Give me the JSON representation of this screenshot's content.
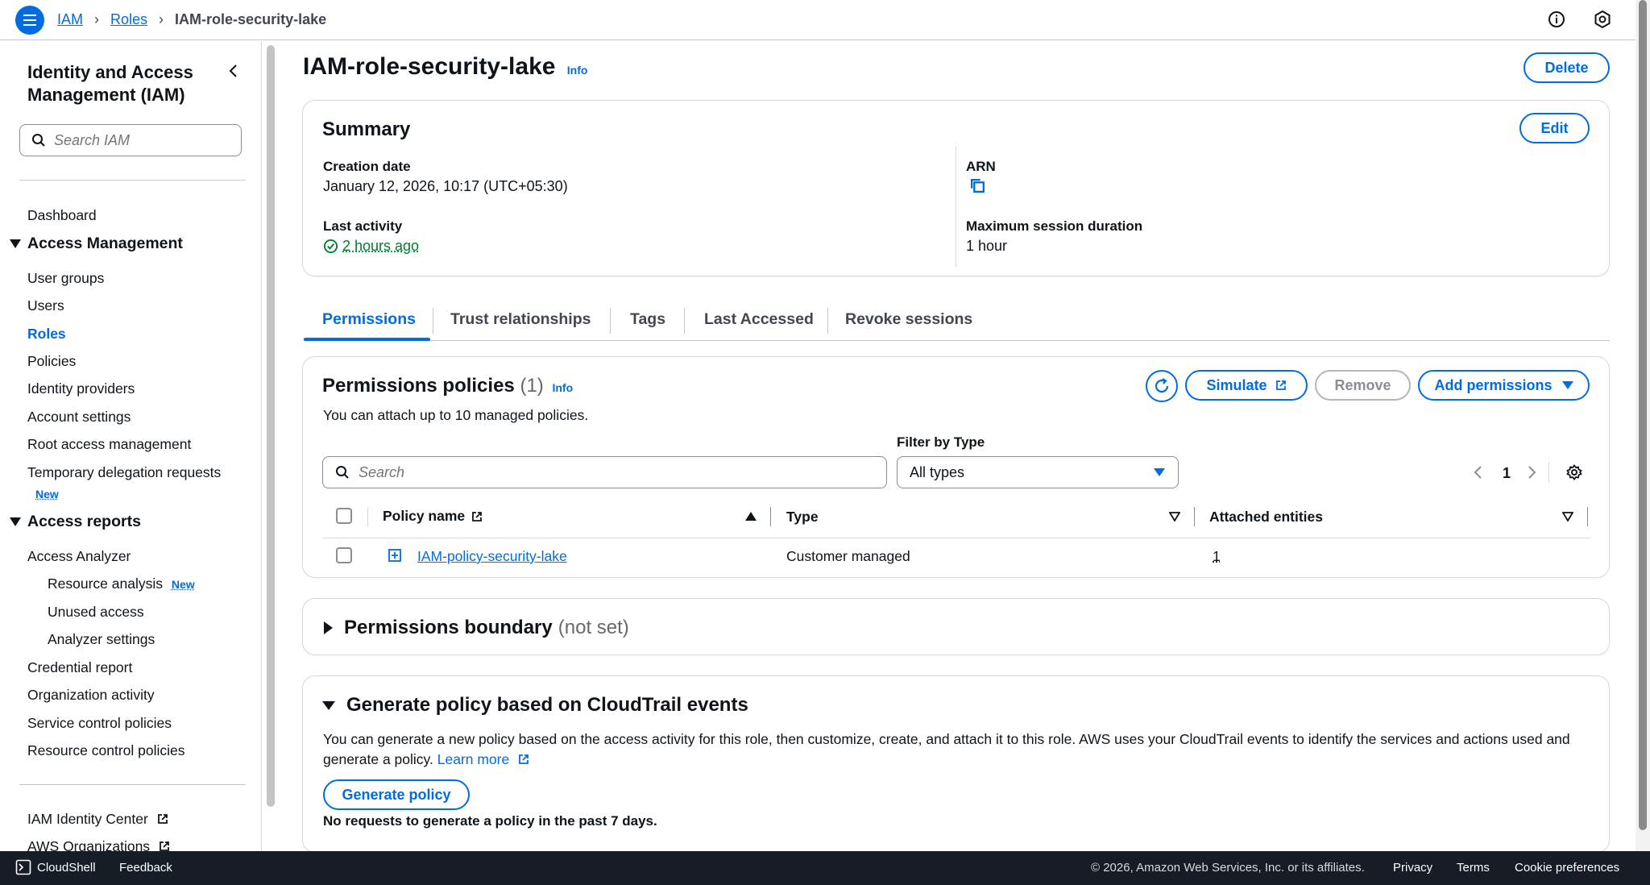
{
  "breadcrumb": {
    "items": [
      "IAM",
      "Roles"
    ],
    "current": "IAM-role-security-lake"
  },
  "sidebar": {
    "title": "Identity and Access Management (IAM)",
    "search_placeholder": "Search IAM",
    "dashboard": "Dashboard",
    "access_management": {
      "label": "Access Management",
      "items": [
        "User groups",
        "Users",
        "Roles",
        "Policies",
        "Identity providers",
        "Account settings",
        "Root access management",
        "Temporary delegation requests"
      ],
      "new_badge": "New"
    },
    "access_reports": {
      "label": "Access reports",
      "access_analyzer": "Access Analyzer",
      "analyzer_items": [
        "Resource analysis",
        "Unused access",
        "Analyzer settings"
      ],
      "new_badge": "New",
      "items": [
        "Credential report",
        "Organization activity",
        "Service control policies",
        "Resource control policies"
      ]
    },
    "external_links": [
      "IAM Identity Center",
      "AWS Organizations"
    ]
  },
  "page": {
    "title": "IAM-role-security-lake",
    "info": "Info",
    "delete_label": "Delete"
  },
  "summary": {
    "heading": "Summary",
    "edit_label": "Edit",
    "creation_date_label": "Creation date",
    "creation_date": "January 12, 2026, 10:17 (UTC+05:30)",
    "arn_label": "ARN",
    "last_activity_label": "Last activity",
    "last_activity": "2 hours ago",
    "max_session_label": "Maximum session duration",
    "max_session": "1 hour"
  },
  "tabs": [
    "Permissions",
    "Trust relationships",
    "Tags",
    "Last Accessed",
    "Revoke sessions"
  ],
  "permissions": {
    "heading": "Permissions policies",
    "count": "(1)",
    "info": "Info",
    "description": "You can attach up to 10 managed policies.",
    "simulate_label": "Simulate",
    "remove_label": "Remove",
    "add_label": "Add permissions",
    "filter_label": "Filter by Type",
    "filter_value": "All types",
    "search_placeholder": "Search",
    "page_number": "1",
    "columns": [
      "Policy name",
      "Type",
      "Attached entities"
    ],
    "rows": [
      {
        "name": "IAM-policy-security-lake",
        "type": "Customer managed",
        "entities": "1"
      }
    ]
  },
  "boundary": {
    "heading": "Permissions boundary",
    "status": "(not set)"
  },
  "generate": {
    "heading": "Generate policy based on CloudTrail events",
    "description": "You can generate a new policy based on the access activity for this role, then customize, create, and attach it to this role. AWS uses your CloudTrail events to identify the services and actions used and",
    "description2": "generate a policy.",
    "learn_more": "Learn more",
    "button_label": "Generate policy",
    "note": "No requests to generate a policy in the past 7 days."
  },
  "footer": {
    "cloudshell": "CloudShell",
    "feedback": "Feedback",
    "copyright": "© 2026, Amazon Web Services, Inc. or its affiliates.",
    "privacy": "Privacy",
    "terms": "Terms",
    "cookies": "Cookie preferences"
  },
  "colors": {
    "accent": "#006ce0",
    "success": "#00802f",
    "footer_bg": "#161d26"
  }
}
